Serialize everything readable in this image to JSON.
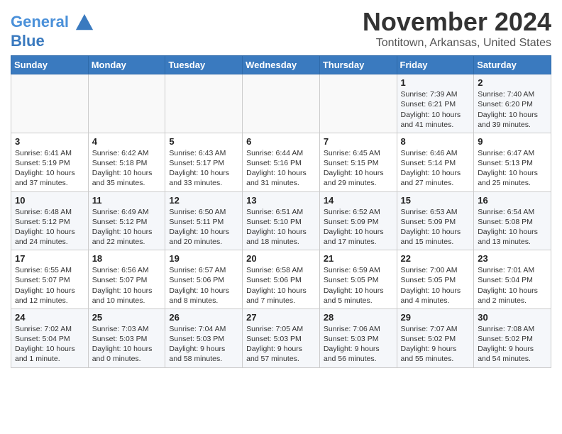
{
  "header": {
    "logo_line1": "General",
    "logo_line2": "Blue",
    "month": "November 2024",
    "location": "Tontitown, Arkansas, United States"
  },
  "weekdays": [
    "Sunday",
    "Monday",
    "Tuesday",
    "Wednesday",
    "Thursday",
    "Friday",
    "Saturday"
  ],
  "weeks": [
    [
      {
        "day": "",
        "info": ""
      },
      {
        "day": "",
        "info": ""
      },
      {
        "day": "",
        "info": ""
      },
      {
        "day": "",
        "info": ""
      },
      {
        "day": "",
        "info": ""
      },
      {
        "day": "1",
        "info": "Sunrise: 7:39 AM\nSunset: 6:21 PM\nDaylight: 10 hours\nand 41 minutes."
      },
      {
        "day": "2",
        "info": "Sunrise: 7:40 AM\nSunset: 6:20 PM\nDaylight: 10 hours\nand 39 minutes."
      }
    ],
    [
      {
        "day": "3",
        "info": "Sunrise: 6:41 AM\nSunset: 5:19 PM\nDaylight: 10 hours\nand 37 minutes."
      },
      {
        "day": "4",
        "info": "Sunrise: 6:42 AM\nSunset: 5:18 PM\nDaylight: 10 hours\nand 35 minutes."
      },
      {
        "day": "5",
        "info": "Sunrise: 6:43 AM\nSunset: 5:17 PM\nDaylight: 10 hours\nand 33 minutes."
      },
      {
        "day": "6",
        "info": "Sunrise: 6:44 AM\nSunset: 5:16 PM\nDaylight: 10 hours\nand 31 minutes."
      },
      {
        "day": "7",
        "info": "Sunrise: 6:45 AM\nSunset: 5:15 PM\nDaylight: 10 hours\nand 29 minutes."
      },
      {
        "day": "8",
        "info": "Sunrise: 6:46 AM\nSunset: 5:14 PM\nDaylight: 10 hours\nand 27 minutes."
      },
      {
        "day": "9",
        "info": "Sunrise: 6:47 AM\nSunset: 5:13 PM\nDaylight: 10 hours\nand 25 minutes."
      }
    ],
    [
      {
        "day": "10",
        "info": "Sunrise: 6:48 AM\nSunset: 5:12 PM\nDaylight: 10 hours\nand 24 minutes."
      },
      {
        "day": "11",
        "info": "Sunrise: 6:49 AM\nSunset: 5:12 PM\nDaylight: 10 hours\nand 22 minutes."
      },
      {
        "day": "12",
        "info": "Sunrise: 6:50 AM\nSunset: 5:11 PM\nDaylight: 10 hours\nand 20 minutes."
      },
      {
        "day": "13",
        "info": "Sunrise: 6:51 AM\nSunset: 5:10 PM\nDaylight: 10 hours\nand 18 minutes."
      },
      {
        "day": "14",
        "info": "Sunrise: 6:52 AM\nSunset: 5:09 PM\nDaylight: 10 hours\nand 17 minutes."
      },
      {
        "day": "15",
        "info": "Sunrise: 6:53 AM\nSunset: 5:09 PM\nDaylight: 10 hours\nand 15 minutes."
      },
      {
        "day": "16",
        "info": "Sunrise: 6:54 AM\nSunset: 5:08 PM\nDaylight: 10 hours\nand 13 minutes."
      }
    ],
    [
      {
        "day": "17",
        "info": "Sunrise: 6:55 AM\nSunset: 5:07 PM\nDaylight: 10 hours\nand 12 minutes."
      },
      {
        "day": "18",
        "info": "Sunrise: 6:56 AM\nSunset: 5:07 PM\nDaylight: 10 hours\nand 10 minutes."
      },
      {
        "day": "19",
        "info": "Sunrise: 6:57 AM\nSunset: 5:06 PM\nDaylight: 10 hours\nand 8 minutes."
      },
      {
        "day": "20",
        "info": "Sunrise: 6:58 AM\nSunset: 5:06 PM\nDaylight: 10 hours\nand 7 minutes."
      },
      {
        "day": "21",
        "info": "Sunrise: 6:59 AM\nSunset: 5:05 PM\nDaylight: 10 hours\nand 5 minutes."
      },
      {
        "day": "22",
        "info": "Sunrise: 7:00 AM\nSunset: 5:05 PM\nDaylight: 10 hours\nand 4 minutes."
      },
      {
        "day": "23",
        "info": "Sunrise: 7:01 AM\nSunset: 5:04 PM\nDaylight: 10 hours\nand 2 minutes."
      }
    ],
    [
      {
        "day": "24",
        "info": "Sunrise: 7:02 AM\nSunset: 5:04 PM\nDaylight: 10 hours\nand 1 minute."
      },
      {
        "day": "25",
        "info": "Sunrise: 7:03 AM\nSunset: 5:03 PM\nDaylight: 10 hours\nand 0 minutes."
      },
      {
        "day": "26",
        "info": "Sunrise: 7:04 AM\nSunset: 5:03 PM\nDaylight: 9 hours\nand 58 minutes."
      },
      {
        "day": "27",
        "info": "Sunrise: 7:05 AM\nSunset: 5:03 PM\nDaylight: 9 hours\nand 57 minutes."
      },
      {
        "day": "28",
        "info": "Sunrise: 7:06 AM\nSunset: 5:03 PM\nDaylight: 9 hours\nand 56 minutes."
      },
      {
        "day": "29",
        "info": "Sunrise: 7:07 AM\nSunset: 5:02 PM\nDaylight: 9 hours\nand 55 minutes."
      },
      {
        "day": "30",
        "info": "Sunrise: 7:08 AM\nSunset: 5:02 PM\nDaylight: 9 hours\nand 54 minutes."
      }
    ]
  ]
}
